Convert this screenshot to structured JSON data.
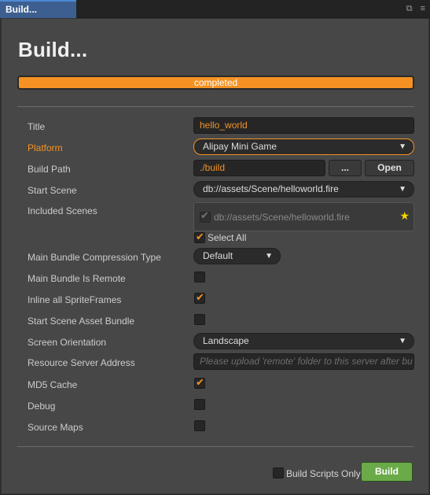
{
  "tab": {
    "title": "Build..."
  },
  "page": {
    "title": "Build..."
  },
  "progress": {
    "text": "completed",
    "percent": 100
  },
  "fields": {
    "title": {
      "label": "Title",
      "value": "hello_world"
    },
    "platform": {
      "label": "Platform",
      "value": "Alipay Mini Game"
    },
    "build_path": {
      "label": "Build Path",
      "value": "./build",
      "browse_label": "...",
      "open_label": "Open"
    },
    "start_scene": {
      "label": "Start Scene",
      "value": "db://assets/Scene/helloworld.fire"
    },
    "included_scenes": {
      "label": "Included Scenes",
      "scene": "db://assets/Scene/helloworld.fire",
      "select_all_label": "Select All"
    },
    "compression": {
      "label": "Main Bundle Compression Type",
      "value": "Default"
    },
    "bundle_remote": {
      "label": "Main Bundle Is Remote",
      "checked": false
    },
    "inline_sprites": {
      "label": "Inline all SpriteFrames",
      "checked": true
    },
    "start_scene_bundle": {
      "label": "Start Scene Asset Bundle",
      "checked": false
    },
    "orientation": {
      "label": "Screen Orientation",
      "value": "Landscape"
    },
    "resource_server": {
      "label": "Resource Server Address",
      "placeholder": "Please upload 'remote' folder to this server after bu"
    },
    "md5": {
      "label": "MD5 Cache",
      "checked": true
    },
    "debug": {
      "label": "Debug",
      "checked": false
    },
    "source_maps": {
      "label": "Source Maps",
      "checked": false
    }
  },
  "footer": {
    "build_scripts_only_label": "Build Scripts Only",
    "build_label": "Build"
  },
  "icons": {
    "tick": "✔",
    "arrow": "▼",
    "star": "★",
    "window": "⧉",
    "menu": "≡"
  },
  "colors": {
    "accent": "#f29325",
    "build_button": "#6aaa48",
    "tab": "#3c5f8f"
  }
}
